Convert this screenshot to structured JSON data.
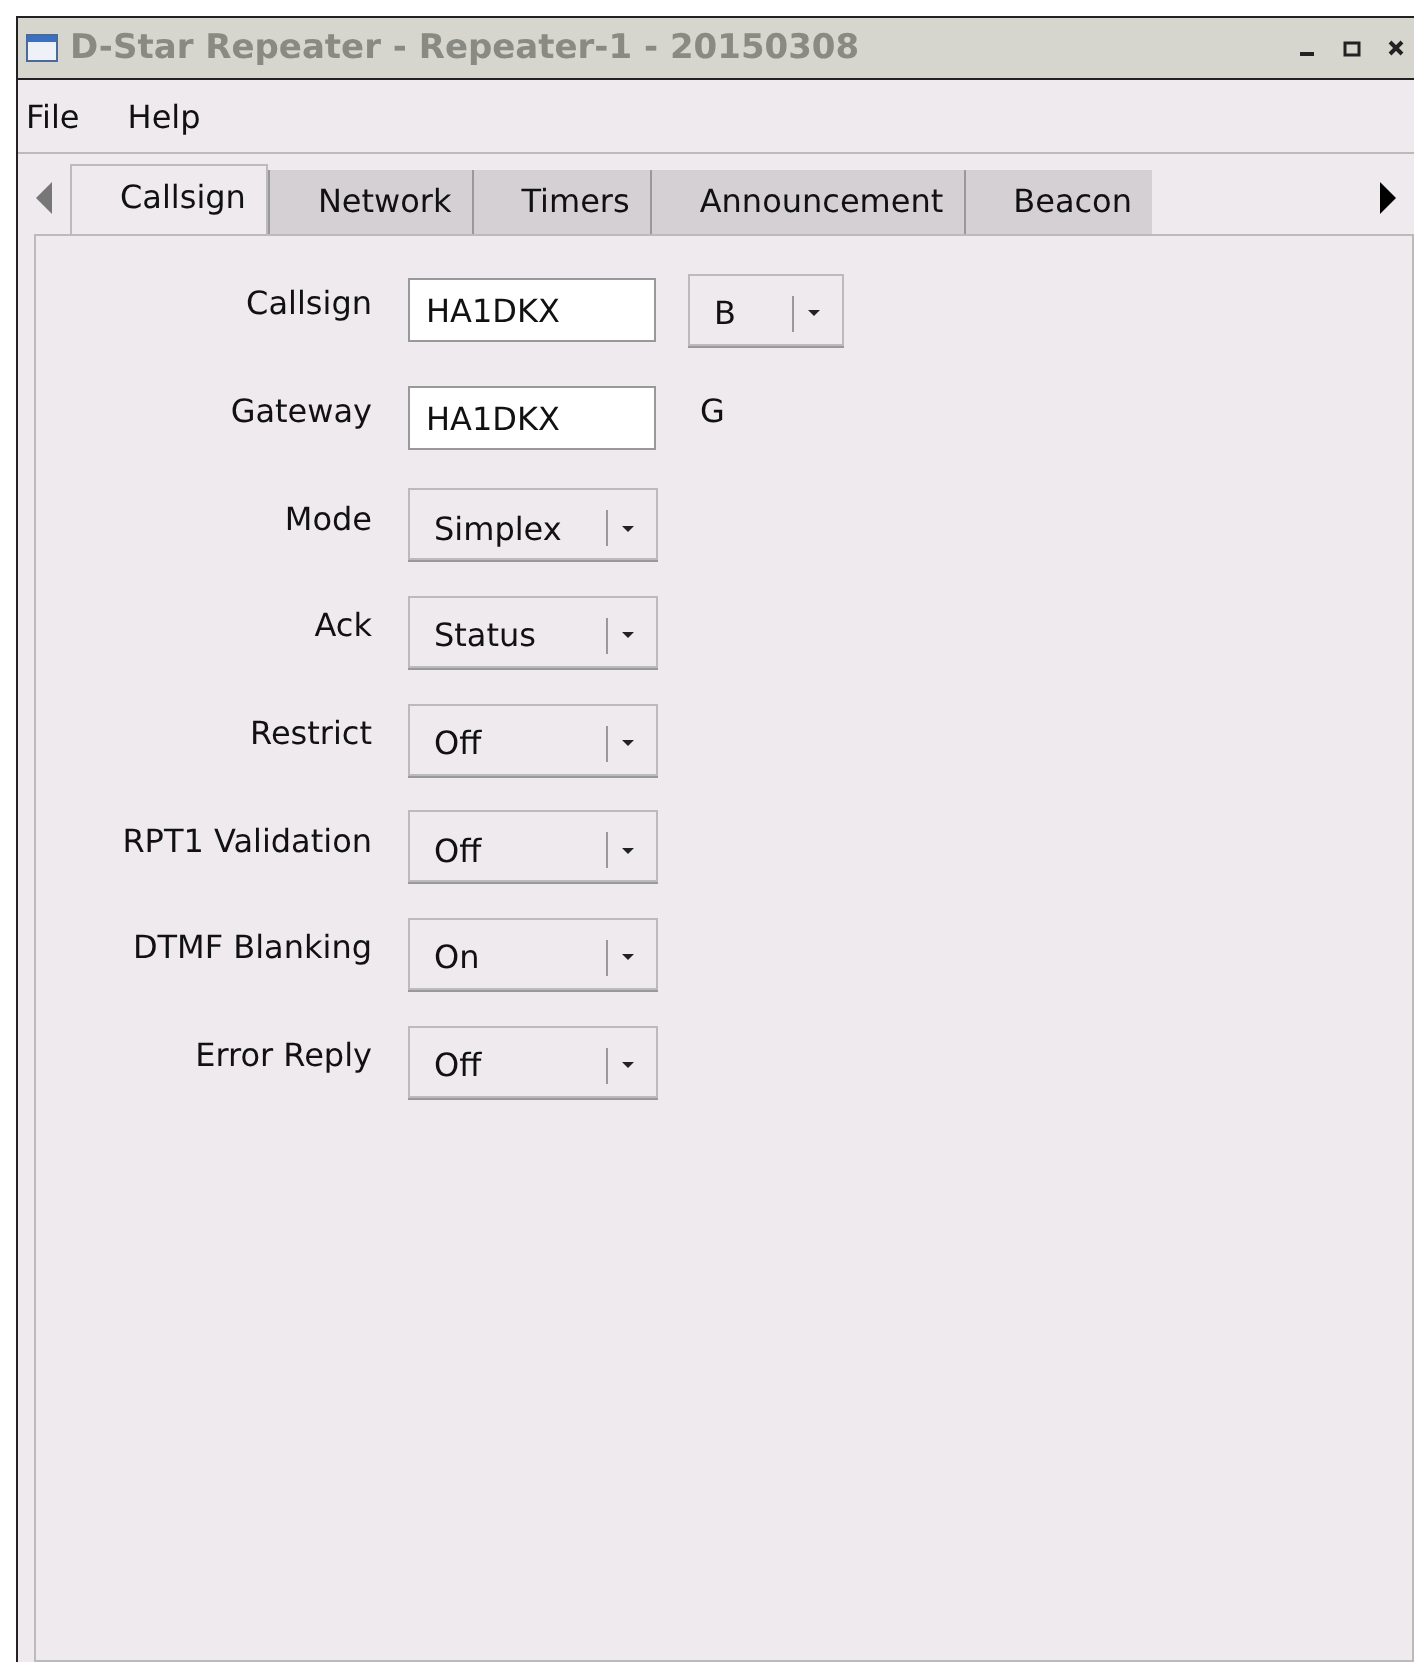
{
  "window": {
    "title": "D-Star Repeater - Repeater-1 - 20150308"
  },
  "menu": [
    "File",
    "Help"
  ],
  "tabs": [
    {
      "label": "Callsign",
      "selected": true
    },
    {
      "label": "Network",
      "selected": false
    },
    {
      "label": "Timers",
      "selected": false
    },
    {
      "label": "Announcement",
      "selected": false
    },
    {
      "label": "Beacon",
      "selected": false
    }
  ],
  "rows": [
    {
      "label": "Callsign",
      "widgets": [
        {
          "kind": "entry",
          "value": "HA1DKX"
        },
        {
          "kind": "combo",
          "value": "B"
        }
      ]
    },
    {
      "label": "Gateway",
      "widgets": [
        {
          "kind": "entry",
          "value": "HA1DKX"
        },
        {
          "kind": "text",
          "value": "G"
        }
      ]
    },
    {
      "label": "Mode",
      "widgets": [
        {
          "kind": "combo",
          "value": "Simplex"
        }
      ]
    },
    {
      "label": "Ack",
      "widgets": [
        {
          "kind": "combo",
          "value": "Status"
        }
      ]
    },
    {
      "label": "Restrict",
      "widgets": [
        {
          "kind": "combo",
          "value": "Off"
        }
      ]
    },
    {
      "label": "RPT1 Validation",
      "widgets": [
        {
          "kind": "combo",
          "value": "Off"
        }
      ]
    },
    {
      "label": "DTMF Blanking",
      "widgets": [
        {
          "kind": "combo",
          "value": "On"
        }
      ]
    },
    {
      "label": "Error Reply",
      "widgets": [
        {
          "kind": "combo",
          "value": "Off"
        }
      ]
    }
  ]
}
